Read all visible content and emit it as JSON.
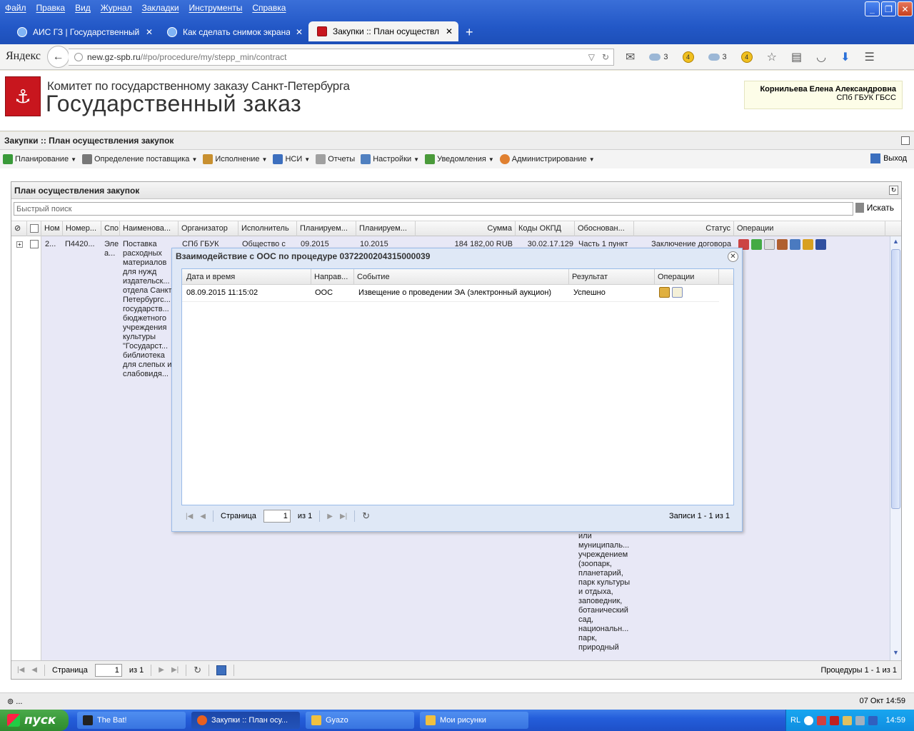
{
  "browser": {
    "menu": [
      "Файл",
      "Правка",
      "Вид",
      "Журнал",
      "Закладки",
      "Инструменты",
      "Справка"
    ],
    "tabs": [
      {
        "label": "АИС ГЗ | Государственный ...",
        "active": false
      },
      {
        "label": "Как сделать снимок экрана ...",
        "active": false
      },
      {
        "label": "Закупки :: План осуществл...",
        "active": true
      }
    ],
    "yandex_logo": "Яндекс",
    "url_host": "new.gz-spb.ru",
    "url_path": "/#po/procedure/my/stepp_min/contract",
    "nav_badges": [
      "3",
      "4",
      "3",
      "4"
    ]
  },
  "site": {
    "org_name": "Комитет по государственному заказу Санкт-Петербурга",
    "brand": "Государственный заказ",
    "user_name": "Корнильева Елена Александровна",
    "user_org": "СПб ГБУК ГБСС"
  },
  "app": {
    "title": "Закупки :: План осуществления закупок",
    "menu": [
      {
        "label": "Планирование",
        "color": "#3a9a3a"
      },
      {
        "label": "Определение поставщика",
        "color": "#777777"
      },
      {
        "label": "Исполнение",
        "color": "#c89030"
      },
      {
        "label": "НСИ",
        "color": "#3d6fbe"
      },
      {
        "label": "Отчеты",
        "color": "#a0a0a0"
      },
      {
        "label": "Настройки",
        "color": "#5080c0"
      },
      {
        "label": "Уведомления",
        "color": "#4a9a3a"
      },
      {
        "label": "Администрирование",
        "color": "#e08030"
      }
    ],
    "logout": "Выход"
  },
  "panel": {
    "title": "План осуществления закупок",
    "search_placeholder": "Быстрый поиск",
    "search_button": "Искать",
    "columns": [
      "Ном",
      "Номер...",
      "Спо",
      "Наименова...",
      "Организатор",
      "Исполнитель",
      "Планируем...",
      "Планируем...",
      "Сумма",
      "Коды ОКПД",
      "Обоснован...",
      "Статус",
      "Операции"
    ],
    "row": {
      "num": "2...",
      "number": "П4420...",
      "method": "Эле а...",
      "name": "Поставка расходных материалов для нужд издательск... отдела Санкт Петербургс... государств... бюджетного учреждения культуры \"Государст... библиотека для слепых и слабовидя...",
      "organizer": "СПб ГБУК",
      "executor": "Общество с",
      "plan1": "09.2015",
      "plan2": "10.2015",
      "sum": "184 182,00 RUB",
      "okpd": "30.02.17.129",
      "basis_top": "Часть 1 пункт",
      "basis_bottom": "или муниципаль... учреждением (зоопарк, планетарий, парк культуры и отдыха, заповедник, ботанический сад, национальн... парк, природный",
      "status": "Заключение договора"
    },
    "pager": {
      "page_label": "Страница",
      "page": "1",
      "of": "из 1",
      "summary": "Процедуры 1 - 1 из 1"
    }
  },
  "dialog": {
    "title": "Взаимодействие с ООС по процедуре 0372200204315000039",
    "columns": [
      "Дата и время",
      "Направ...",
      "Событие",
      "Результат",
      "Операции"
    ],
    "rows": [
      {
        "datetime": "08.09.2015 11:15:02",
        "direction": "ООС",
        "event": "Извещение о проведении ЭА (электронный аукцион)",
        "result": "Успешно"
      }
    ],
    "pager": {
      "page_label": "Страница",
      "page": "1",
      "of": "из 1",
      "summary": "Записи 1 - 1 из 1"
    }
  },
  "status_bar": {
    "left": "⊚ ...",
    "right": "07 Окт 14:59"
  },
  "taskbar": {
    "start": "пуск",
    "tasks": [
      {
        "label": "The Bat!",
        "active": false
      },
      {
        "label": "Закупки :: План осу...",
        "active": true
      },
      {
        "label": "Gyazo",
        "active": false
      },
      {
        "label": "Мои рисунки",
        "active": false
      }
    ],
    "lang": "RL",
    "clock": "14:59"
  }
}
